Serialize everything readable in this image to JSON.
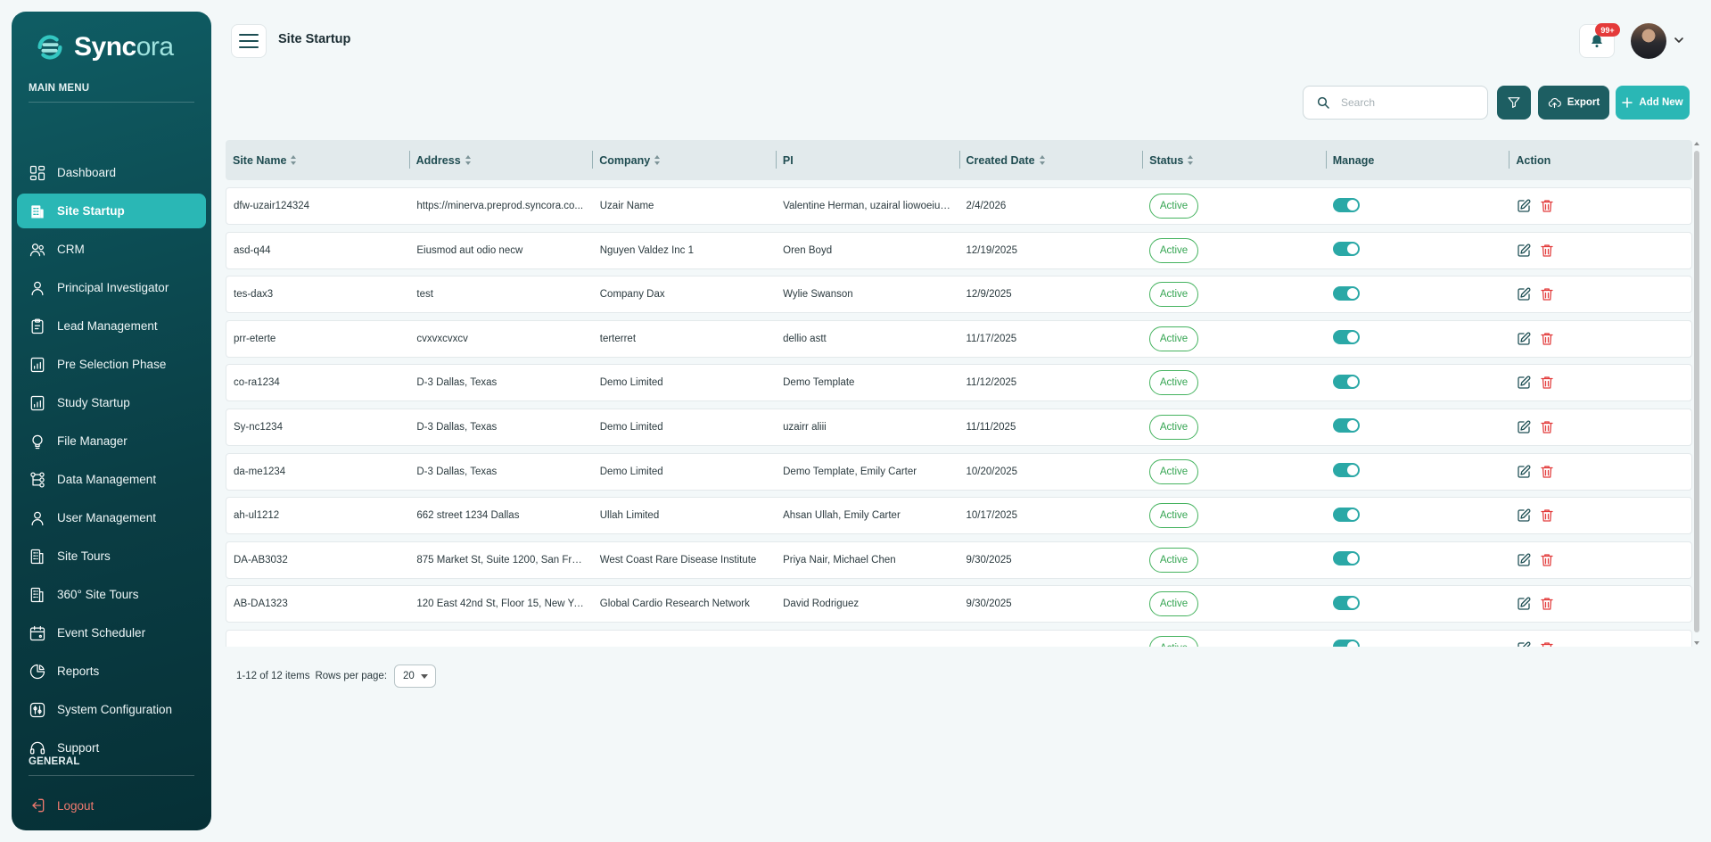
{
  "brand": {
    "name_bold": "Sync",
    "name_light": "ora"
  },
  "sidebar": {
    "main_menu_label": "MAIN MENU",
    "general_label": "GENERAL",
    "logout_label": "Logout",
    "items": [
      {
        "label": "Dashboard",
        "icon": "dashboard-icon",
        "active": false
      },
      {
        "label": "Site Startup",
        "icon": "building-icon",
        "active": true
      },
      {
        "label": "CRM",
        "icon": "users-icon",
        "active": false
      },
      {
        "label": "Principal Investigator",
        "icon": "user-icon",
        "active": false
      },
      {
        "label": "Lead Management",
        "icon": "clipboard-icon",
        "active": false
      },
      {
        "label": "Pre Selection Phase",
        "icon": "chart-doc-icon",
        "active": false
      },
      {
        "label": "Study Startup",
        "icon": "chart-doc-icon",
        "active": false
      },
      {
        "label": "File Manager",
        "icon": "bulb-icon",
        "active": false
      },
      {
        "label": "Data Management",
        "icon": "hierarchy-icon",
        "active": false
      },
      {
        "label": "User Management",
        "icon": "user-icon",
        "active": false
      },
      {
        "label": "Site Tours",
        "icon": "site-tour-icon",
        "active": false
      },
      {
        "label": "360° Site Tours",
        "icon": "site-tour-icon",
        "active": false
      },
      {
        "label": "Event Scheduler",
        "icon": "calendar-icon",
        "active": false
      },
      {
        "label": "Reports",
        "icon": "pie-icon",
        "active": false
      },
      {
        "label": "System Configuration",
        "icon": "settings-icon",
        "active": false
      },
      {
        "label": "Support",
        "icon": "headset-icon",
        "active": false
      }
    ]
  },
  "header": {
    "title": "Site Startup",
    "notification_count": "99+"
  },
  "toolbar": {
    "search_placeholder": "Search",
    "export_label": "Export",
    "add_label": "Add New"
  },
  "table": {
    "columns": [
      "Site Name",
      "Address",
      "Company",
      "PI",
      "Created Date",
      "Status",
      "Manage",
      "Action"
    ],
    "sortable": [
      true,
      true,
      true,
      false,
      true,
      true,
      false,
      false
    ],
    "rows": [
      {
        "site": "dfw-uzair124324",
        "address": "https://minerva.preprod.syncora.co...",
        "company": "Uzair Name",
        "pi": "Valentine Herman, uzairal liowoeiu, ...",
        "date": "2/4/2026",
        "status": "Active"
      },
      {
        "site": "asd-q44",
        "address": "Eiusmod aut odio necw",
        "company": "Nguyen Valdez Inc 1",
        "pi": "Oren Boyd",
        "date": "12/19/2025",
        "status": "Active"
      },
      {
        "site": "tes-dax3",
        "address": "test",
        "company": "Company Dax",
        "pi": "Wylie Swanson",
        "date": "12/9/2025",
        "status": "Active"
      },
      {
        "site": "prr-eterte",
        "address": "cvxvxcvxcv",
        "company": "terterret",
        "pi": "dellio astt",
        "date": "11/17/2025",
        "status": "Active"
      },
      {
        "site": "co-ra1234",
        "address": "D-3 Dallas, Texas",
        "company": "Demo Limited",
        "pi": "Demo Template",
        "date": "11/12/2025",
        "status": "Active"
      },
      {
        "site": "Sy-nc1234",
        "address": "D-3 Dallas, Texas",
        "company": "Demo Limited",
        "pi": "uzairr aliii",
        "date": "11/11/2025",
        "status": "Active"
      },
      {
        "site": "da-me1234",
        "address": "D-3 Dallas, Texas",
        "company": "Demo Limited",
        "pi": "Demo Template, Emily Carter",
        "date": "10/20/2025",
        "status": "Active"
      },
      {
        "site": "ah-ul1212",
        "address": "662 street 1234 Dallas",
        "company": "Ullah Limited",
        "pi": "Ahsan Ullah, Emily Carter",
        "date": "10/17/2025",
        "status": "Active"
      },
      {
        "site": "DA-AB3032",
        "address": "875 Market St, Suite 1200, San Franc...",
        "company": "West Coast Rare Disease Institute",
        "pi": "Priya Nair, Michael Chen",
        "date": "9/30/2025",
        "status": "Active"
      },
      {
        "site": "AB-DA1323",
        "address": "120 East 42nd St, Floor 15, New York,...",
        "company": "Global Cardio Research Network",
        "pi": "David Rodriguez",
        "date": "9/30/2025",
        "status": "Active"
      },
      {
        "site": "",
        "address": "",
        "company": "",
        "pi": "",
        "date": "",
        "status": "Active"
      }
    ]
  },
  "pagination": {
    "summary": "1-12 of 12 items",
    "rows_label": "Rows per page:",
    "rows_value": "20"
  },
  "colors": {
    "accent": "#2ab7b5",
    "dark_teal": "#1d5e62",
    "active_green": "#35a552",
    "delete_red": "#e23b3b",
    "logout_red": "#f07a6f"
  }
}
